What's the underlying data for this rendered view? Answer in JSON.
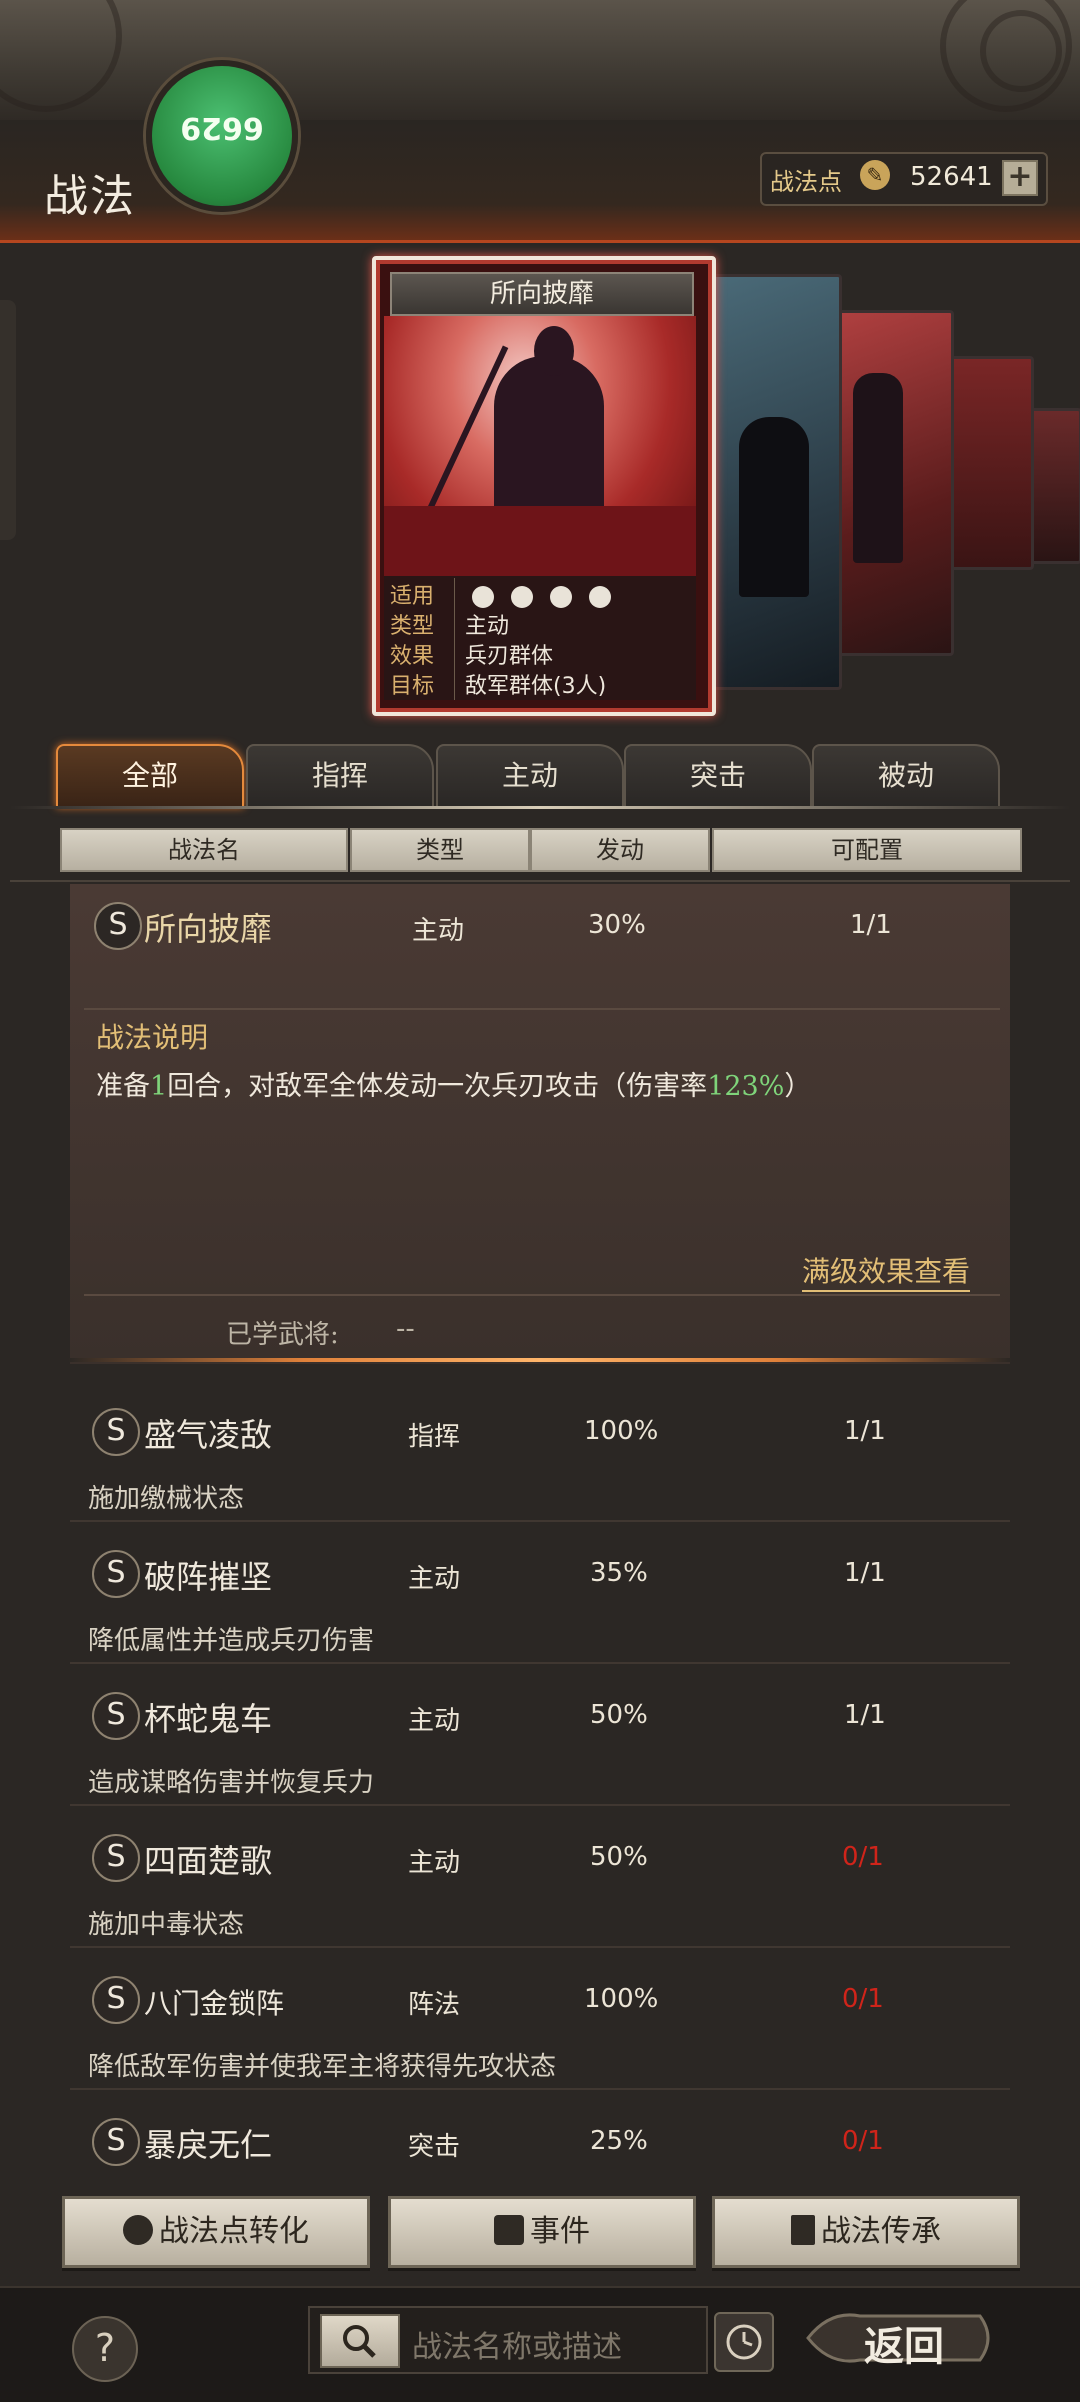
{
  "header": {
    "title": "战法",
    "badge_text": "6629",
    "points_label": "战法点",
    "points_value": "52641",
    "add_label": "+"
  },
  "featured_card": {
    "name": "所向披靡",
    "info": [
      {
        "key": "适用",
        "value": ""
      },
      {
        "key": "类型",
        "value": "主动"
      },
      {
        "key": "效果",
        "value": "兵刃群体"
      },
      {
        "key": "目标",
        "value": "敌军群体(3人)"
      }
    ],
    "applicable_icons": [
      "cavalry-icon",
      "shield-icon",
      "bow-icon",
      "wheel-icon"
    ]
  },
  "tabs": [
    "全部",
    "指挥",
    "主动",
    "突击",
    "被动"
  ],
  "active_tab": "全部",
  "columns": [
    "战法名",
    "类型",
    "发动",
    "可配置"
  ],
  "expanded": {
    "grade": "S",
    "name": "所向披靡",
    "type": "主动",
    "rate": "30%",
    "slots": "1/1",
    "desc_title": "战法说明",
    "desc_prefix": "准备",
    "desc_rounds": "1",
    "desc_middle": "回合，对敌军全体发动一次兵刃攻击（伤害率",
    "desc_percent": "123%",
    "desc_suffix": "）",
    "full_level_link": "满级效果查看",
    "learned_label": "已学武将:",
    "learned_value": "--"
  },
  "rows": [
    {
      "grade": "S",
      "name": "盛气凌敌",
      "type": "指挥",
      "rate": "100%",
      "slots": "1/1",
      "desc": "施加缴械状态",
      "slots_red": false
    },
    {
      "grade": "S",
      "name": "破阵摧坚",
      "type": "主动",
      "rate": "35%",
      "slots": "1/1",
      "desc": "降低属性并造成兵刃伤害",
      "slots_red": false
    },
    {
      "grade": "S",
      "name": "杯蛇鬼车",
      "type": "主动",
      "rate": "50%",
      "slots": "1/1",
      "desc": "造成谋略伤害并恢复兵力",
      "slots_red": false
    },
    {
      "grade": "S",
      "name": "四面楚歌",
      "type": "主动",
      "rate": "50%",
      "slots": "0/1",
      "desc": "施加中毒状态",
      "slots_red": true
    },
    {
      "grade": "S",
      "name": "八门金锁阵",
      "type": "阵法",
      "rate": "100%",
      "slots": "0/1",
      "desc": "降低敌军伤害并使我军主将获得先攻状态",
      "slots_red": true
    },
    {
      "grade": "S",
      "name": "暴戾无仁",
      "type": "突击",
      "rate": "25%",
      "slots": "0/1",
      "desc": "",
      "slots_red": true
    }
  ],
  "buttons": {
    "convert": "战法点转化",
    "events": "事件",
    "inherit": "战法传承"
  },
  "bottom": {
    "help": "?",
    "search_placeholder": "战法名称或描述",
    "back": "返回"
  },
  "colors": {
    "accent_orange": "#e58a3c",
    "gold_text": "#e2be76",
    "red_slot": "#d0241a",
    "green_value": "#7fd47a"
  }
}
